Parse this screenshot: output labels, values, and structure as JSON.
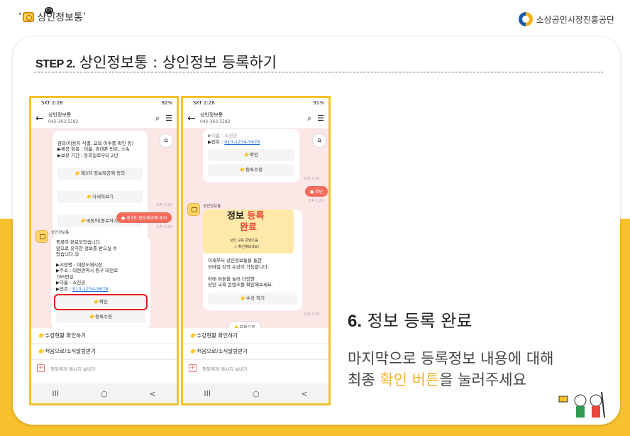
{
  "header": {
    "brand_name": "상인정보통",
    "brand_badge": "Ch",
    "agency_name": "소상공인시장진흥공단"
  },
  "page": {
    "step_label": "STEP 2.",
    "title": "상인정보통 : 상인정보 등록하기"
  },
  "phone1": {
    "status_left": "SKT 2:28",
    "status_right": "92%",
    "channel_name": "상인정보통",
    "channel_phone": "042-363-5582",
    "msg_top": "관리(이용자 식별, 교육 이수를 확인 등)\n▶제공 항목 : 이름, 휴대폰 번호, 소속\n▶보유 기간 : 동의일로부터 2년",
    "btn_agree": "👉제3자 정보제공에 동의",
    "btn_detail": "👉자세히보기",
    "btn_disagree": "👉비동의(종료하기)",
    "time1": "오후 2:28",
    "user_chip": "● 제3자 정보제공에 동의",
    "time2": "오후 2:28",
    "sender": "상인정보통",
    "done_text": "등록이 완료되었습니다.\n앞으로 유익한 정보를 받으실 수\n있습니다.😊",
    "info_market": "▶시장명 : 대전도매시장",
    "info_address": "▶주소 : 대전광역시 동구 대전로\n785번길",
    "info_name": "▶이름 : 소진공",
    "info_phone_label": "▶번호 : ",
    "info_phone": "010-1234-5678",
    "btn_confirm": "👉확인",
    "btn_edit": "👉등록수정",
    "quick_reply_1": "👉수강현황 확인하기",
    "quick_reply_2": "👉처음으로/소식알림받기",
    "input_placeholder": "챗봇에게 메시지 보내기",
    "nav_recent": "III",
    "nav_home": "○",
    "nav_back": "<"
  },
  "phone2": {
    "status_left": "SKT 2:28",
    "status_right": "91%",
    "channel_name": "상인정보통",
    "channel_phone": "042-363-5582",
    "top_name": "▶이름 : 소진공",
    "info_phone_label": "▶번호 : ",
    "info_phone": "010-1234-5678",
    "btn_confirm": "👉확인",
    "btn_edit": "👉등록수정",
    "time1": "오후 2:28",
    "user_chip": "● 확인",
    "time2": "오후 2:28",
    "sender": "상인정보통",
    "banner_line1_a": "정보 ",
    "banner_line1_b": "등록",
    "banner_line2": "완료",
    "banner_line3": "상인 교육 콘텐츠를",
    "banner_line4": "➚ 확인해보세요!",
    "msg_body": "이제부터 상인정보통을 통한\n모바일 강의 수강이 가능합니다.\n\n아래 버튼을 눌러 다양한\n상인 교육 콘텐츠를 확인해보세요.",
    "btn_course": "👉수강 하기",
    "time3": "오후 2:28",
    "btn_home": "👉처음으로",
    "quick_reply_1": "👉수강현황 확인하기",
    "quick_reply_2": "👉처음으로/소식알림받기",
    "input_placeholder": "챗봇에게 메시지 보내기",
    "nav_recent": "III",
    "nav_home": "○",
    "nav_back": "<"
  },
  "instruction": {
    "step_number": "6.",
    "step_title": "정보 등록 완료",
    "line1": "마지막으로 등록정보 내용에 대해",
    "line2_pre": "최종 ",
    "line2_accent": "확인 버튼",
    "line2_post": "을 눌러주세요"
  },
  "colors": {
    "accent_yellow": "#f6c12d",
    "highlight_red": "#e0151c",
    "chat_bg": "#fce7e7",
    "chip": "#f26b5b"
  }
}
